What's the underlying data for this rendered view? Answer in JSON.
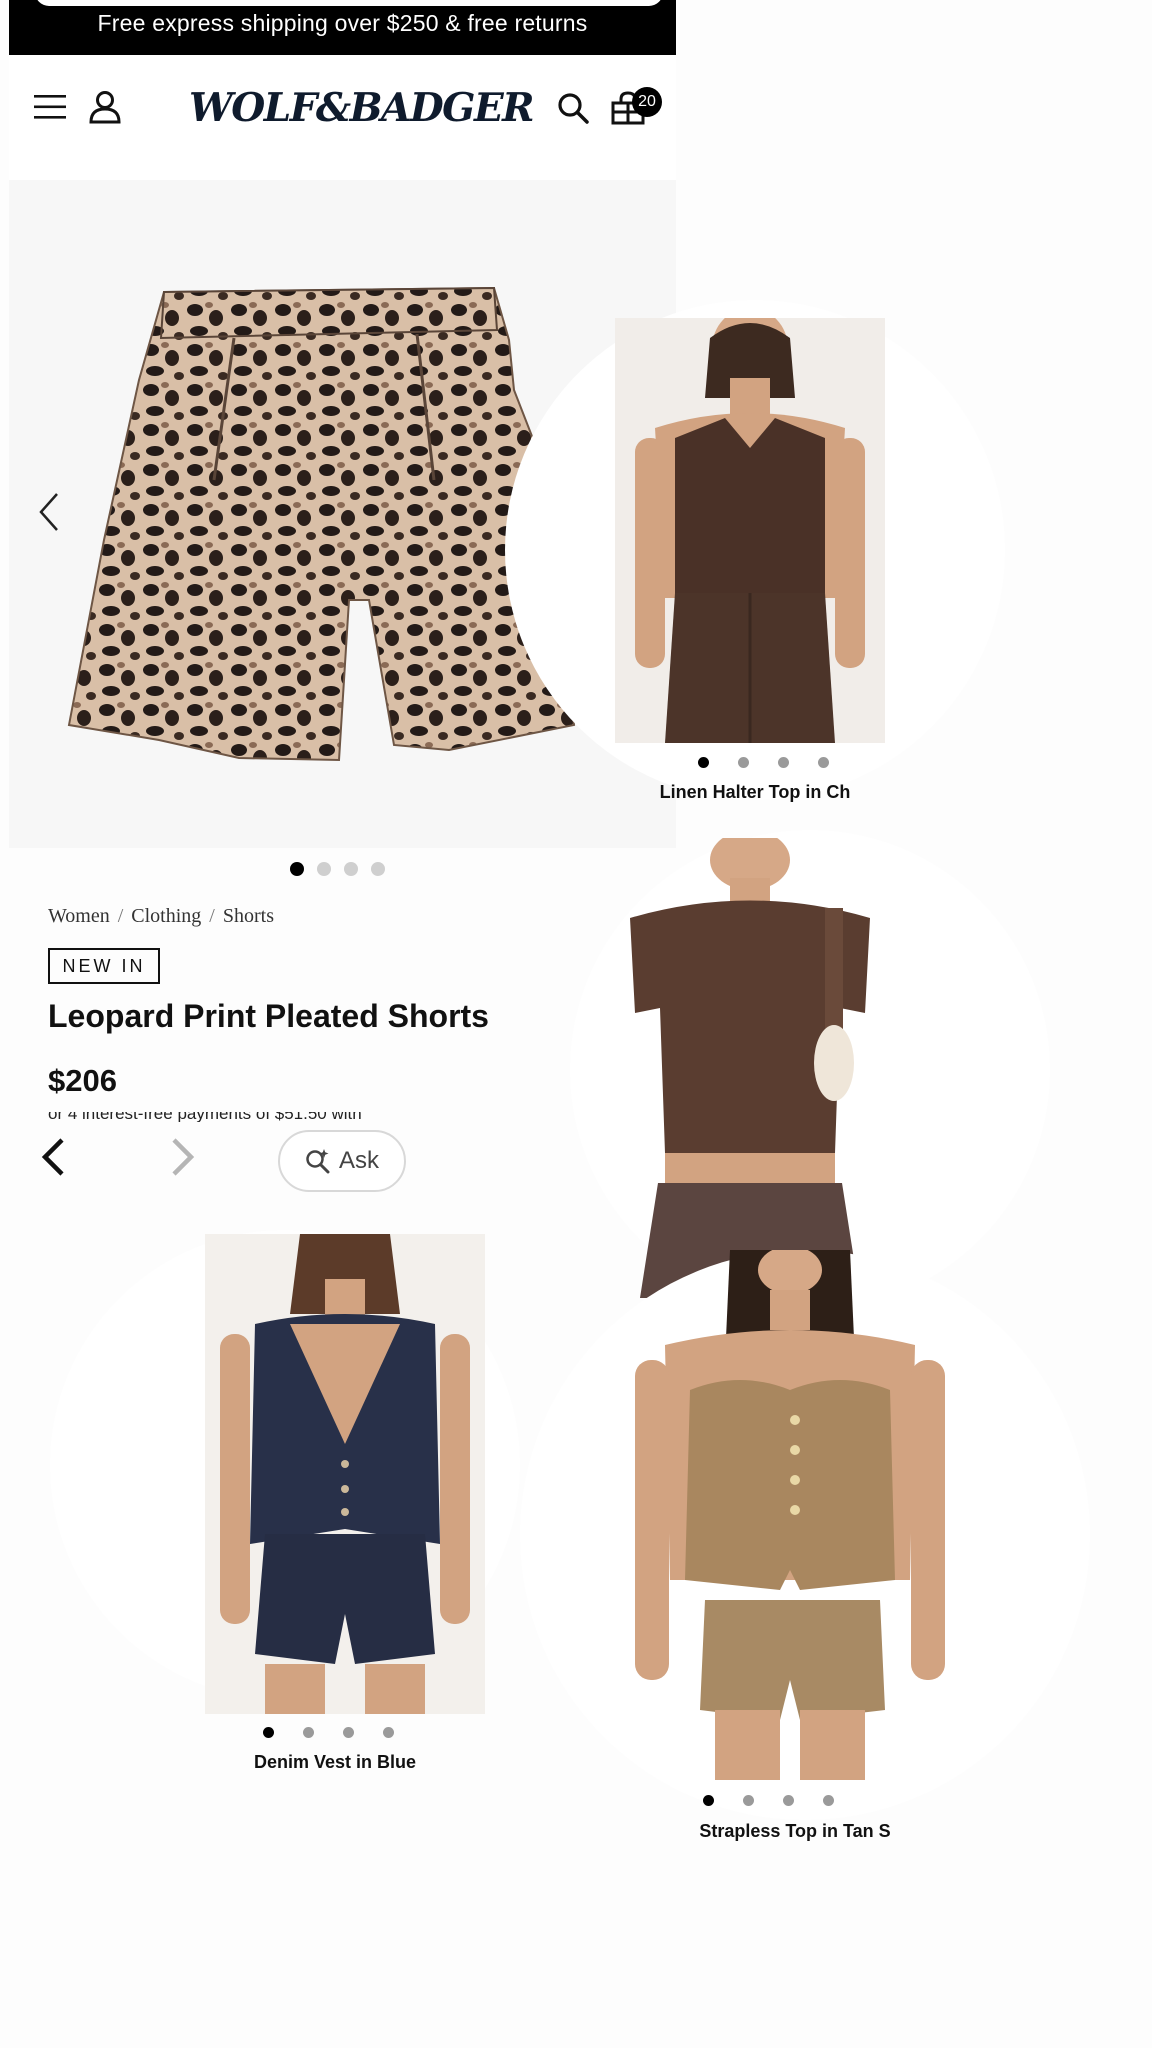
{
  "promo": {
    "text": "Free express shipping over $250 & free returns"
  },
  "header": {
    "logo": "WOLF&BADGER",
    "bag_count": "20",
    "icons": [
      "menu-icon",
      "account-icon",
      "search-icon",
      "bag-icon"
    ]
  },
  "gallery": {
    "slide_count": 4,
    "active_slide": 1
  },
  "product": {
    "breadcrumb": [
      "Women",
      "Clothing",
      "Shorts"
    ],
    "badge": "NEW IN",
    "title": "Leopard Print Pleated Shorts",
    "price": "$206",
    "installments": "or 4 interest-free payments of $51.50 with"
  },
  "overlay": {
    "ask_label": "Ask"
  },
  "recommendations": [
    {
      "caption": "Linen Halter Top in Ch",
      "dots": 4,
      "active_dot": 1
    },
    {
      "caption": "",
      "dots": 0,
      "active_dot": 0
    },
    {
      "caption": "Denim Vest in Blue",
      "dots": 4,
      "active_dot": 1
    },
    {
      "caption": "Strapless Top in Tan S",
      "dots": 4,
      "active_dot": 1
    }
  ],
  "colors": {
    "banner": "#000000",
    "logo": "#0f1b2d",
    "leopard_base": "#d9bfa7",
    "leopard_spot": "#231a17",
    "brown_top": "#4a3127",
    "denim": "#283049",
    "tan": "#a9875f"
  }
}
